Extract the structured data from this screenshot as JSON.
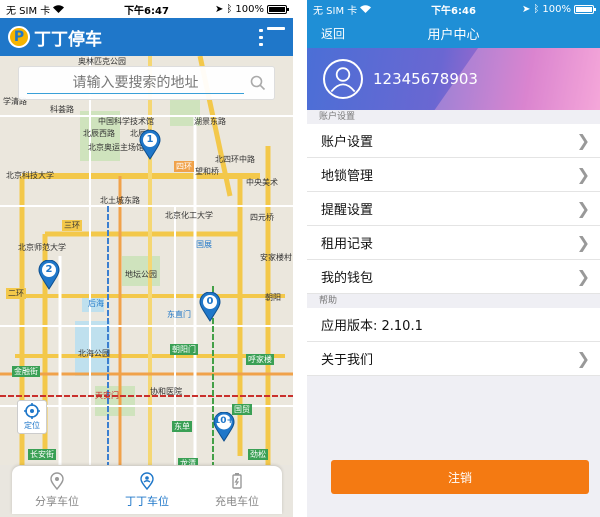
{
  "left": {
    "status": {
      "carrier": "无 SIM 卡",
      "time": "下午6:47",
      "battery": "100%"
    },
    "header": {
      "app_title": "丁丁停车",
      "logo_letter": "P"
    },
    "search": {
      "placeholder": "请输入要搜索的地址"
    },
    "map_labels": [
      "奥林匹克公园",
      "学清路",
      "科荟路",
      "中国科学技术馆",
      "北辰西路",
      "北辰路",
      "湖景东路",
      "北京奥运主场馆",
      "北京科技大学",
      "四环",
      "望和桥",
      "北四环中路",
      "中央美术",
      "北土城东路",
      "北京化工大学",
      "四元桥",
      "三环",
      "北京师范大学",
      "国展",
      "安家楼村",
      "地坛公园",
      "二环",
      "后海",
      "东直门",
      "北海公园",
      "朝阳门",
      "呼家楼",
      "金融街",
      "协和医院",
      "东单",
      "天安门",
      "朝阳",
      "国贸",
      "长安街",
      "龙潭",
      "劲松"
    ],
    "pins": [
      {
        "num": "1"
      },
      {
        "num": "2"
      },
      {
        "num": "0"
      },
      {
        "num": "10+"
      }
    ],
    "locate_label": "定位",
    "tabs": [
      {
        "label": "分享车位",
        "icon": "location-icon"
      },
      {
        "label": "丁丁车位",
        "icon": "person-pin-icon"
      },
      {
        "label": "充电车位",
        "icon": "battery-icon"
      }
    ],
    "colors": {
      "brand": "#1f77c9",
      "accent": "#f5b400"
    }
  },
  "right": {
    "status": {
      "carrier": "无 SIM 卡",
      "time": "下午6:46",
      "battery": "100%"
    },
    "nav": {
      "back": "返回",
      "title": "用户中心"
    },
    "profile": {
      "phone": "12345678903"
    },
    "section_account": "账户设置",
    "account_items": [
      "账户设置",
      "地锁管理",
      "提醒设置",
      "租用记录",
      "我的钱包"
    ],
    "section_help": "帮助",
    "version": "应用版本: 2.10.1",
    "about": "关于我们",
    "logout": "注销",
    "colors": {
      "nav": "#1f8fd6",
      "logout": "#f47a12"
    }
  }
}
